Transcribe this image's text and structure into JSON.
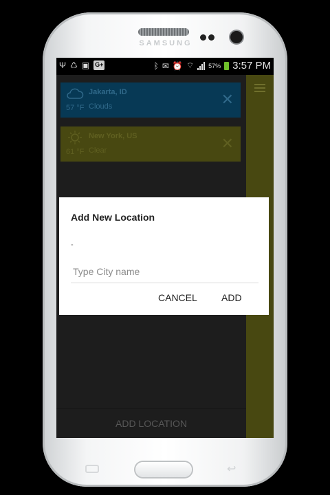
{
  "device": {
    "brand": "SAMSUNG"
  },
  "status_bar": {
    "battery_percent": "57%",
    "time": "3:57 PM"
  },
  "locations": [
    {
      "city": "Jakarta, ID",
      "temp": "57 °F",
      "condition": "Clouds",
      "icon": "cloud-icon",
      "color": "#0a4a6e"
    },
    {
      "city": "New York, US",
      "temp": "61 °F",
      "condition": "Clear",
      "icon": "sun-icon",
      "color": "#5d5d17"
    }
  ],
  "bottom_bar": {
    "add_location_label": "ADD LOCATION"
  },
  "dialog": {
    "title": "Add New Location",
    "dash": "-",
    "input_value": "",
    "input_placeholder": "Type City name",
    "cancel_label": "CANCEL",
    "add_label": "ADD"
  },
  "colors": {
    "accent_olive": "#5d5d17",
    "accent_blue": "#0a4a6e",
    "battery_green": "#6fbf2a"
  }
}
